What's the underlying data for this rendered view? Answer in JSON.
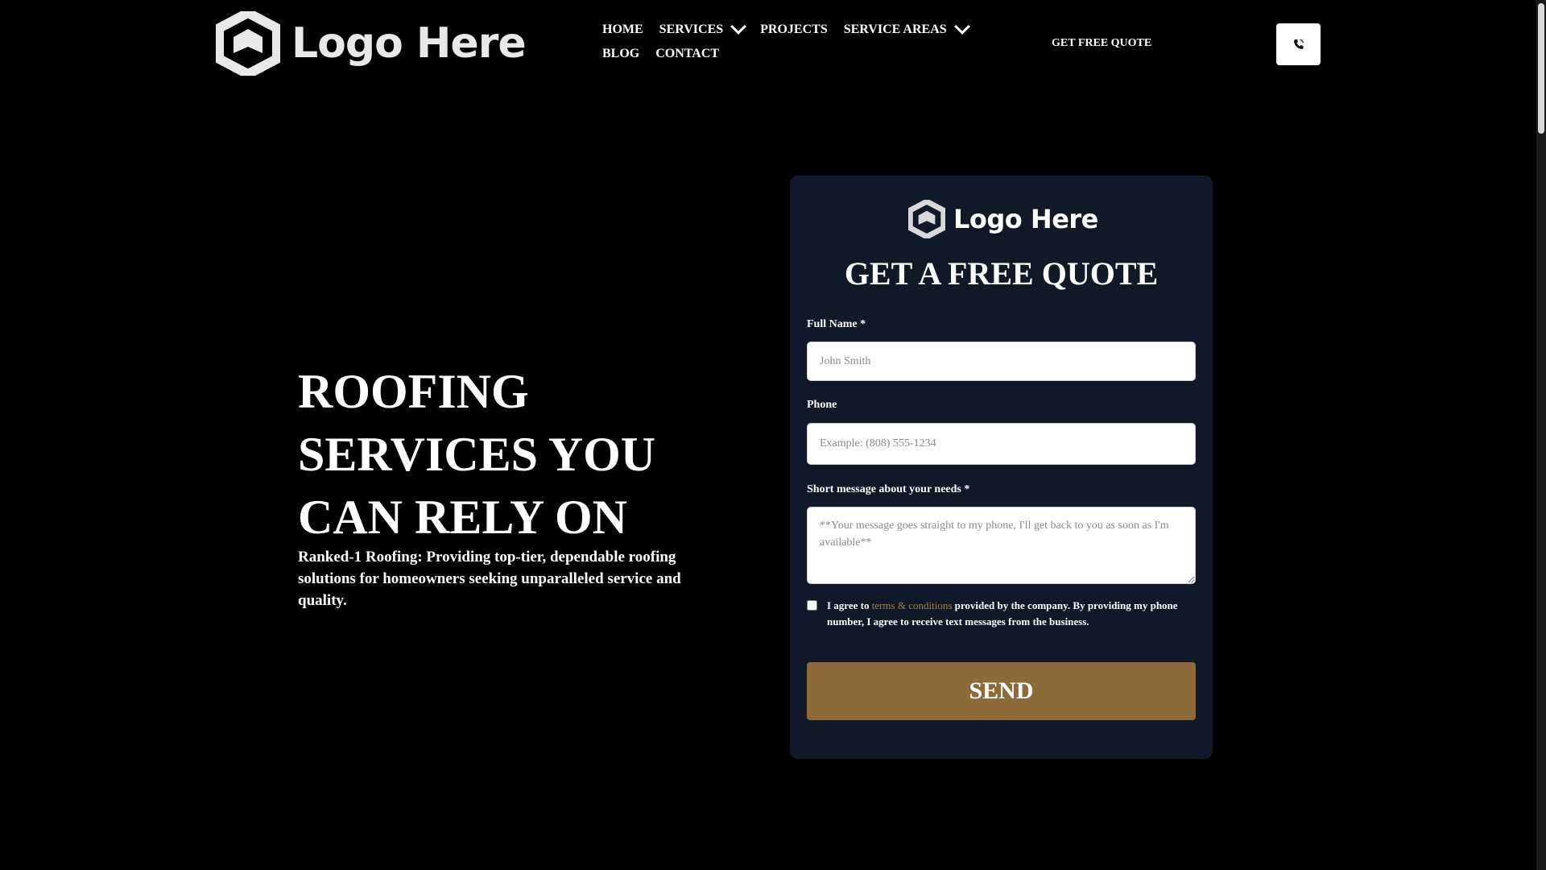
{
  "header": {
    "logo_text": "Logo Here",
    "nav": [
      {
        "label": "HOME"
      },
      {
        "label": "SERVICES"
      },
      {
        "label": "PROJECTS"
      },
      {
        "label": "SERVICE AREAS"
      },
      {
        "label": "BLOG"
      },
      {
        "label": "CONTACT"
      }
    ],
    "quote_link": "GET FREE QUOTE",
    "phone_icon": "phone-icon"
  },
  "hero": {
    "title": "ROOFING SERVICES YOU CAN RELY ON",
    "subtitle": "Ranked-1 Roofing: Providing top-tier, dependable roofing solutions for homeowners seeking unparalleled service and quality."
  },
  "form": {
    "logo_text": "Logo Here",
    "title": "GET A FREE QUOTE",
    "name_label": "Full Name *",
    "name_placeholder": "John Smith",
    "phone_label": "Phone",
    "phone_placeholder": "Example: (808) 555-1234",
    "message_label": "Short message about your needs *",
    "message_placeholder": "**Your message goes straight to my phone, I'll get back to you as soon as I'm available**",
    "consent_prefix": "I agree to ",
    "terms_link": "terms & conditions",
    "consent_suffix": " provided by the company. By providing my phone number, I agree to receive text messages from the business.",
    "send_label": "SEND"
  },
  "colors": {
    "background": "#000000",
    "card": "#111827",
    "accent": "#8e6a3b",
    "link": "#a27d4a"
  }
}
